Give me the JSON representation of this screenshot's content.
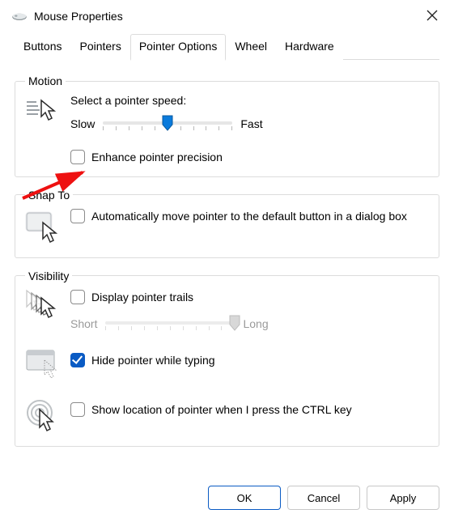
{
  "window": {
    "title": "Mouse Properties"
  },
  "tabs": {
    "items": [
      "Buttons",
      "Pointers",
      "Pointer Options",
      "Wheel",
      "Hardware"
    ],
    "active": 2
  },
  "groups": {
    "motion": {
      "legend": "Motion",
      "select_label": "Select a pointer speed:",
      "slow": "Slow",
      "fast": "Fast",
      "speed_value": 6,
      "speed_min": 1,
      "speed_max": 11,
      "enhance": {
        "checked": false,
        "label": "Enhance pointer precision"
      }
    },
    "snap": {
      "legend": "Snap To",
      "auto": {
        "checked": false,
        "label": "Automatically move pointer to the default button in a dialog box"
      }
    },
    "visibility": {
      "legend": "Visibility",
      "trails": {
        "checked": false,
        "label": "Display pointer trails"
      },
      "trails_short": "Short",
      "trails_long": "Long",
      "trails_value": 11,
      "trails_min": 1,
      "trails_max": 11,
      "hide": {
        "checked": true,
        "label": "Hide pointer while typing"
      },
      "ctrl": {
        "checked": false,
        "label": "Show location of pointer when I press the CTRL key"
      }
    }
  },
  "buttons": {
    "ok": "OK",
    "cancel": "Cancel",
    "apply": "Apply"
  },
  "annotation": {
    "kind": "red-arrow",
    "target": "enhance-pointer-precision-checkbox"
  }
}
